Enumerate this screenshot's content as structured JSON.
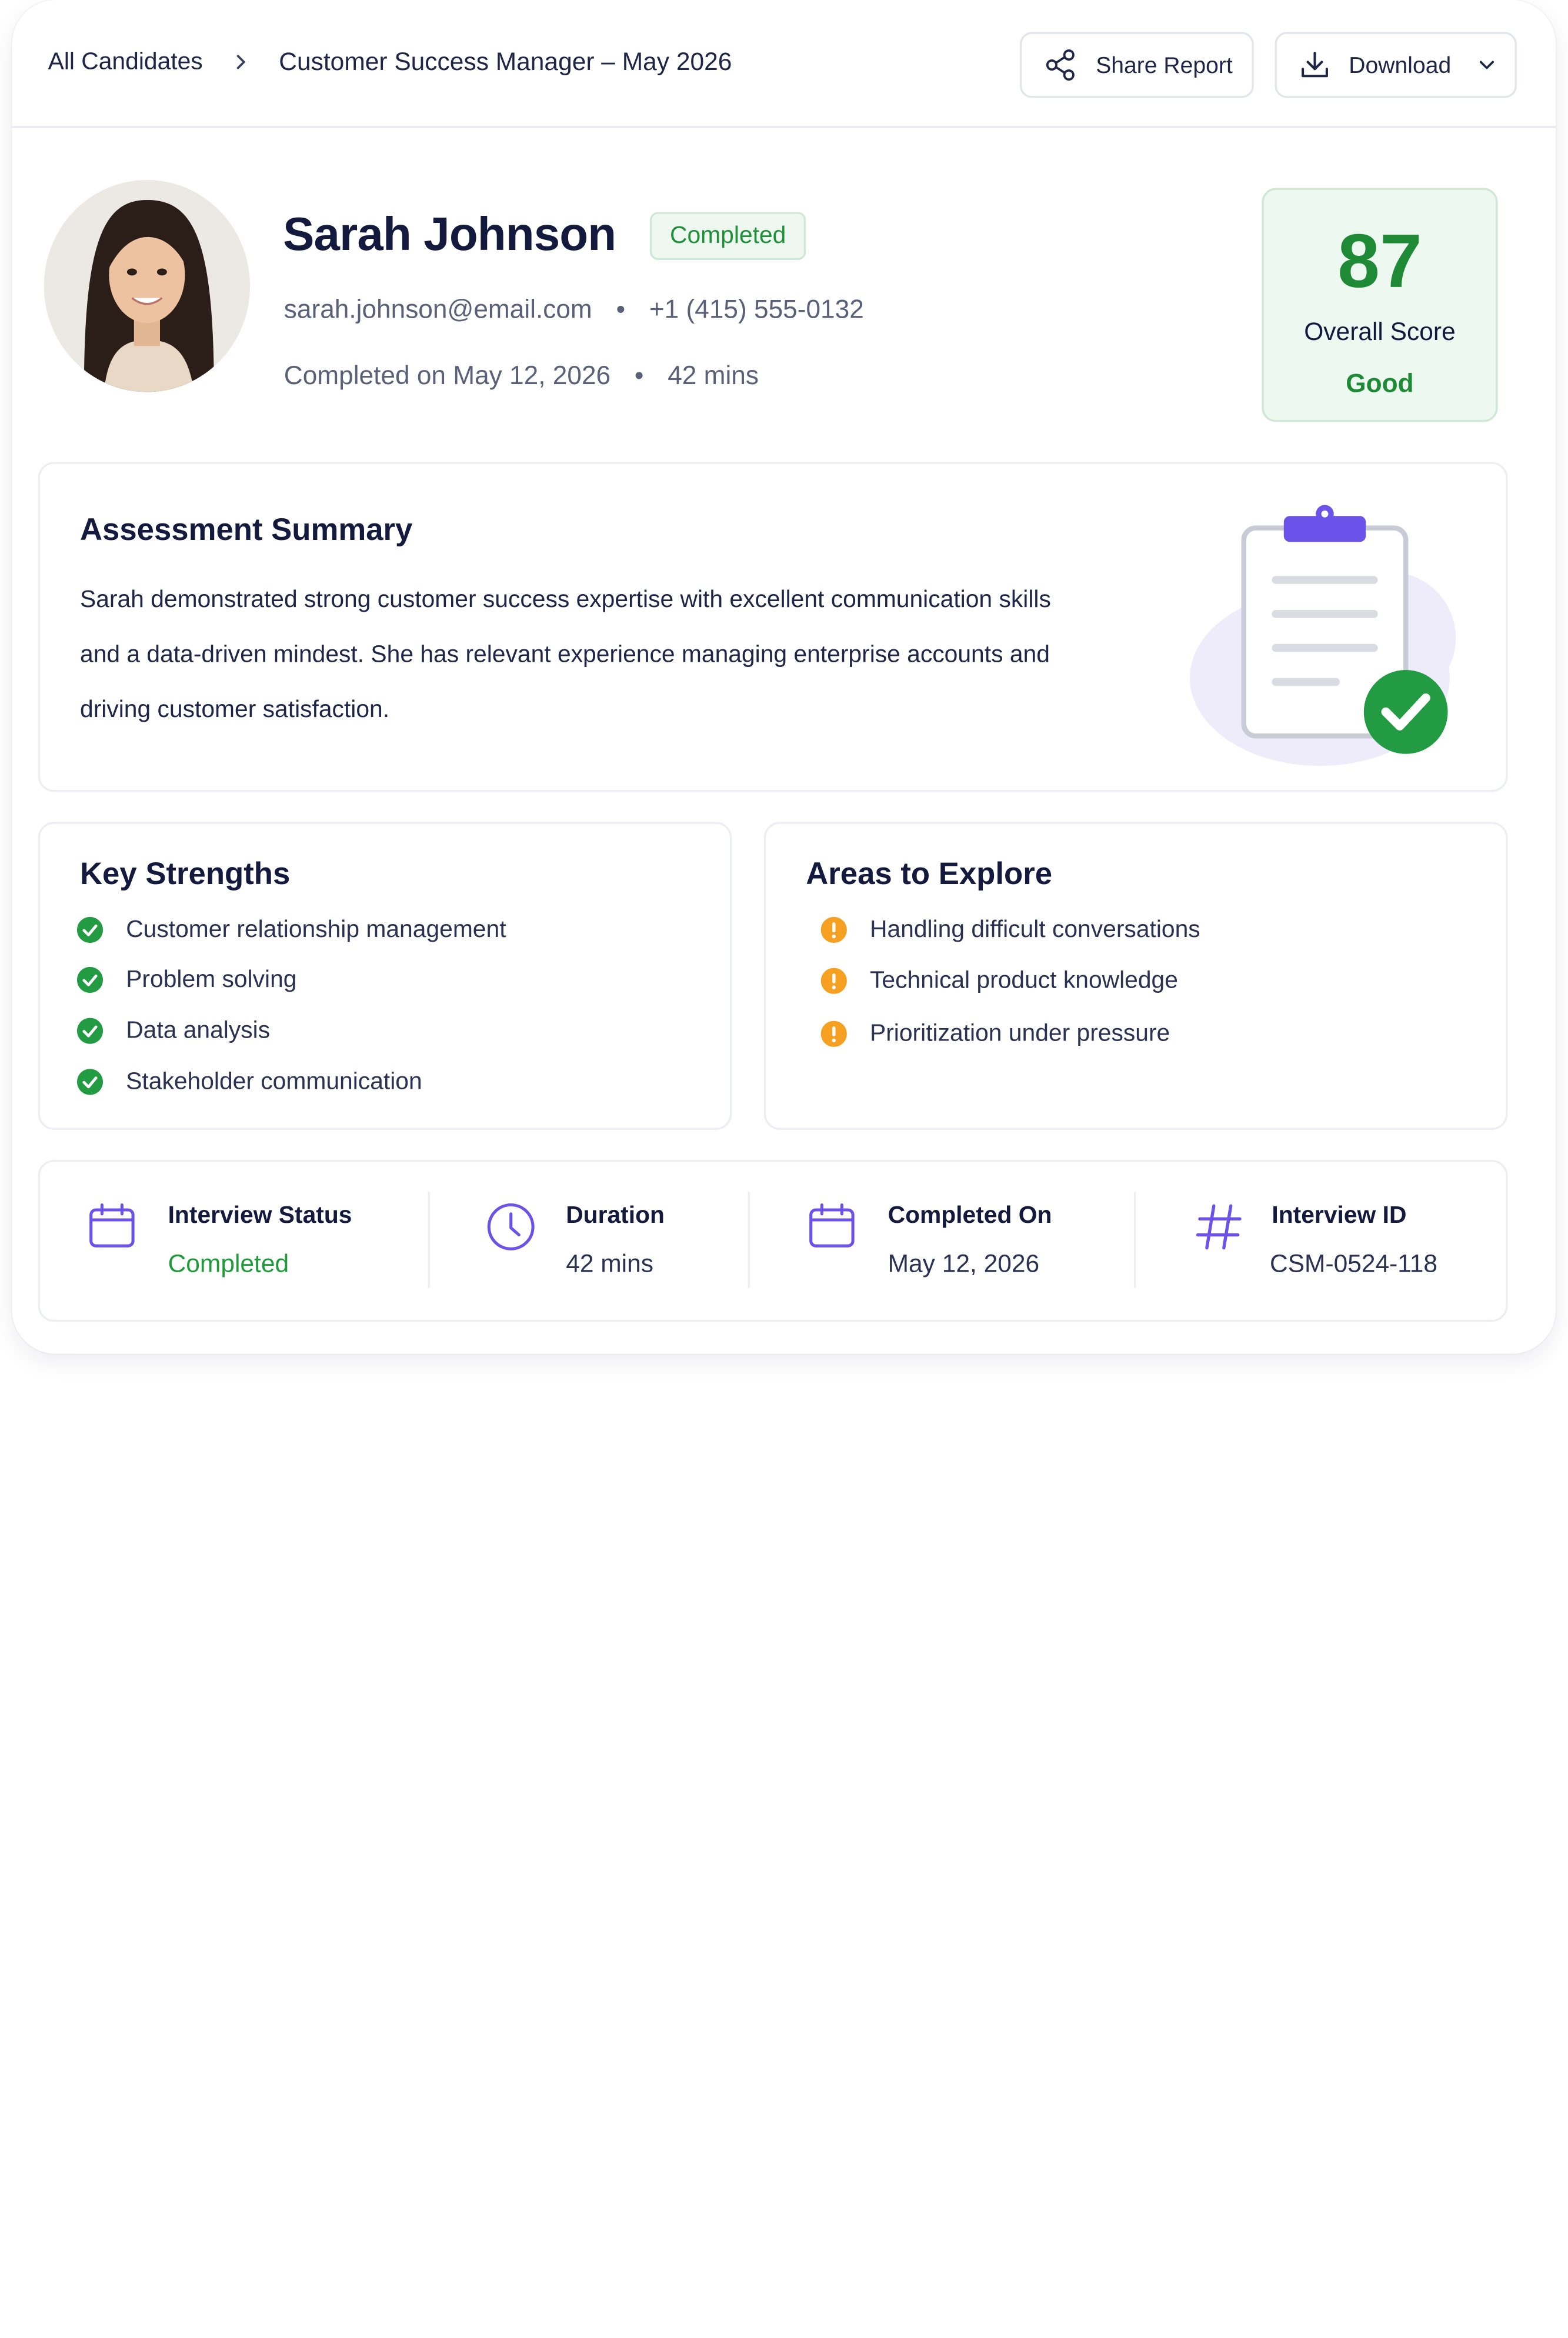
{
  "breadcrumb": {
    "root": "All Candidates",
    "separator": "›",
    "current": "Customer Success Manager – May 2026"
  },
  "toolbar": {
    "share_label": "Share Report",
    "download_label": "Download"
  },
  "candidate": {
    "name": "Sarah Johnson",
    "status_badge": "Completed",
    "email": "sarah.johnson@email.com",
    "phone": "+1 (415) 555-0132",
    "completed_text": "Completed on May 12, 2026",
    "duration": "42 mins",
    "bullet": "•"
  },
  "score": {
    "value": "87",
    "label": "Overall Score",
    "rating": "Good"
  },
  "summary": {
    "title": "Assessment Summary",
    "text": "Sarah demonstrated strong customer success expertise with excellent communication skills and a data-driven mindest. She has relevant experience managing enterprise accounts and driving customer satisfaction."
  },
  "strengths": {
    "title": "Key Strengths",
    "items": [
      "Customer relationship management",
      "Problem solving",
      "Data analysis",
      "Stakeholder communication"
    ]
  },
  "areas": {
    "title": "Areas to Explore",
    "items": [
      "Handling difficult conversations",
      "Technical product knowledge",
      "Prioritization under pressure"
    ]
  },
  "info": {
    "status": {
      "label": "Interview Status",
      "value": "Completed"
    },
    "duration": {
      "label": "Duration",
      "value": "42 mins"
    },
    "completed_on": {
      "label": "Completed On",
      "value": "May 12, 2026"
    },
    "interview_id": {
      "label": "Interview ID",
      "value": "CSM-0524-118"
    }
  },
  "colors": {
    "accent_purple": "#6b52e8",
    "success_green": "#1e8a36",
    "warning_orange": "#f5a021",
    "text_dark": "#131a3d"
  }
}
